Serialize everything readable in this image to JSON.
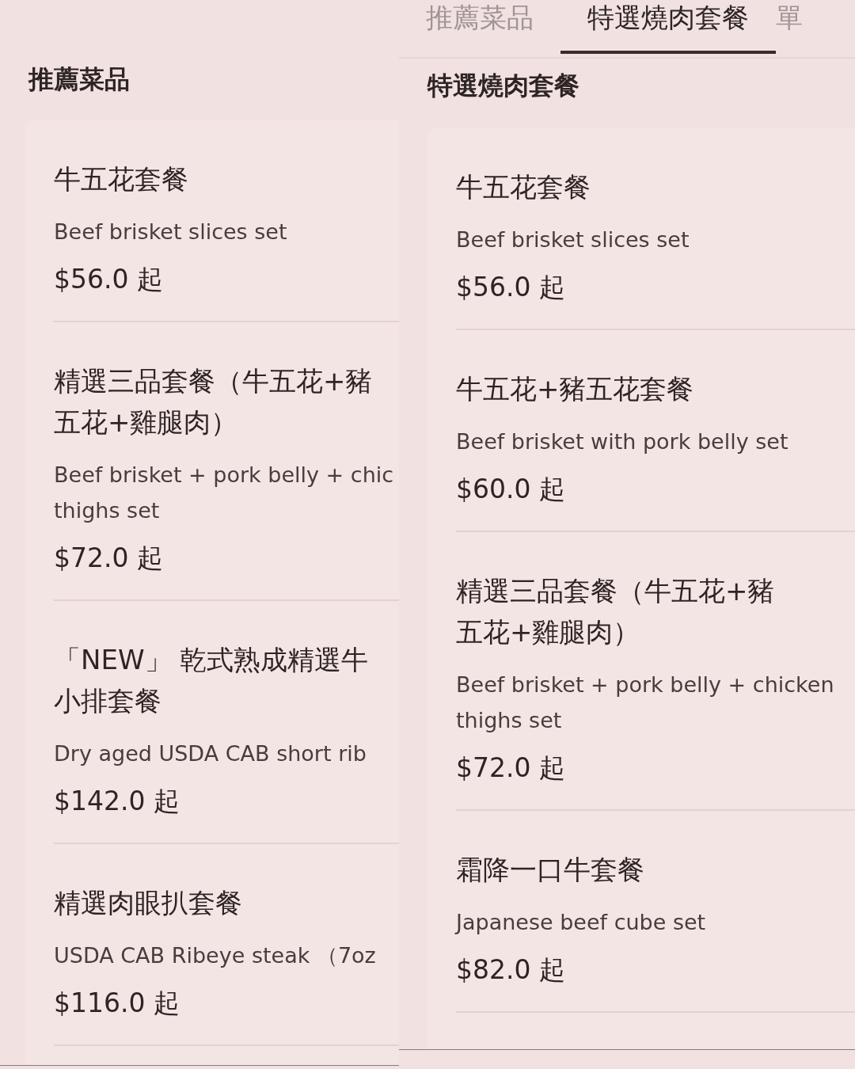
{
  "panels": [
    {
      "heading": "推薦菜品",
      "items": [
        {
          "name": "牛五花套餐",
          "description_lines": [
            "Beef brisket slices set"
          ],
          "price": "$56.0 起"
        },
        {
          "name": "精選三品套餐（牛五花+豬五花+雞腿肉）",
          "description_lines": [
            "Beef brisket + pork belly + chic",
            "thighs set"
          ],
          "price": "$72.0 起"
        },
        {
          "name": "「NEW」 乾式熟成精選牛小排套餐",
          "description_lines": [
            "Dry aged USDA CAB short rib"
          ],
          "price": "$142.0 起"
        },
        {
          "name": "精選肉眼扒套餐",
          "description_lines": [
            "USDA CAB Ribeye steak （7oz"
          ],
          "price": "$116.0 起"
        }
      ]
    },
    {
      "tabs": [
        {
          "label": "推薦菜品",
          "selected": false
        },
        {
          "label": "特選燒肉套餐",
          "selected": true
        },
        {
          "label": "單",
          "selected": false
        }
      ],
      "heading": "特選燒肉套餐",
      "items": [
        {
          "name": "牛五花套餐",
          "description_lines": [
            "Beef brisket slices set"
          ],
          "price": "$56.0 起"
        },
        {
          "name": "牛五花+豬五花套餐",
          "description_lines": [
            "Beef brisket with pork belly set"
          ],
          "price": "$60.0 起"
        },
        {
          "name": "精選三品套餐（牛五花+豬五花+雞腿肉）",
          "description_lines": [
            "Beef brisket + pork belly + chicken",
            "thighs set"
          ],
          "price": "$72.0 起"
        },
        {
          "name": "霜降一口牛套餐",
          "description_lines": [
            "Japanese beef cube set"
          ],
          "price": "$82.0 起"
        }
      ]
    }
  ]
}
